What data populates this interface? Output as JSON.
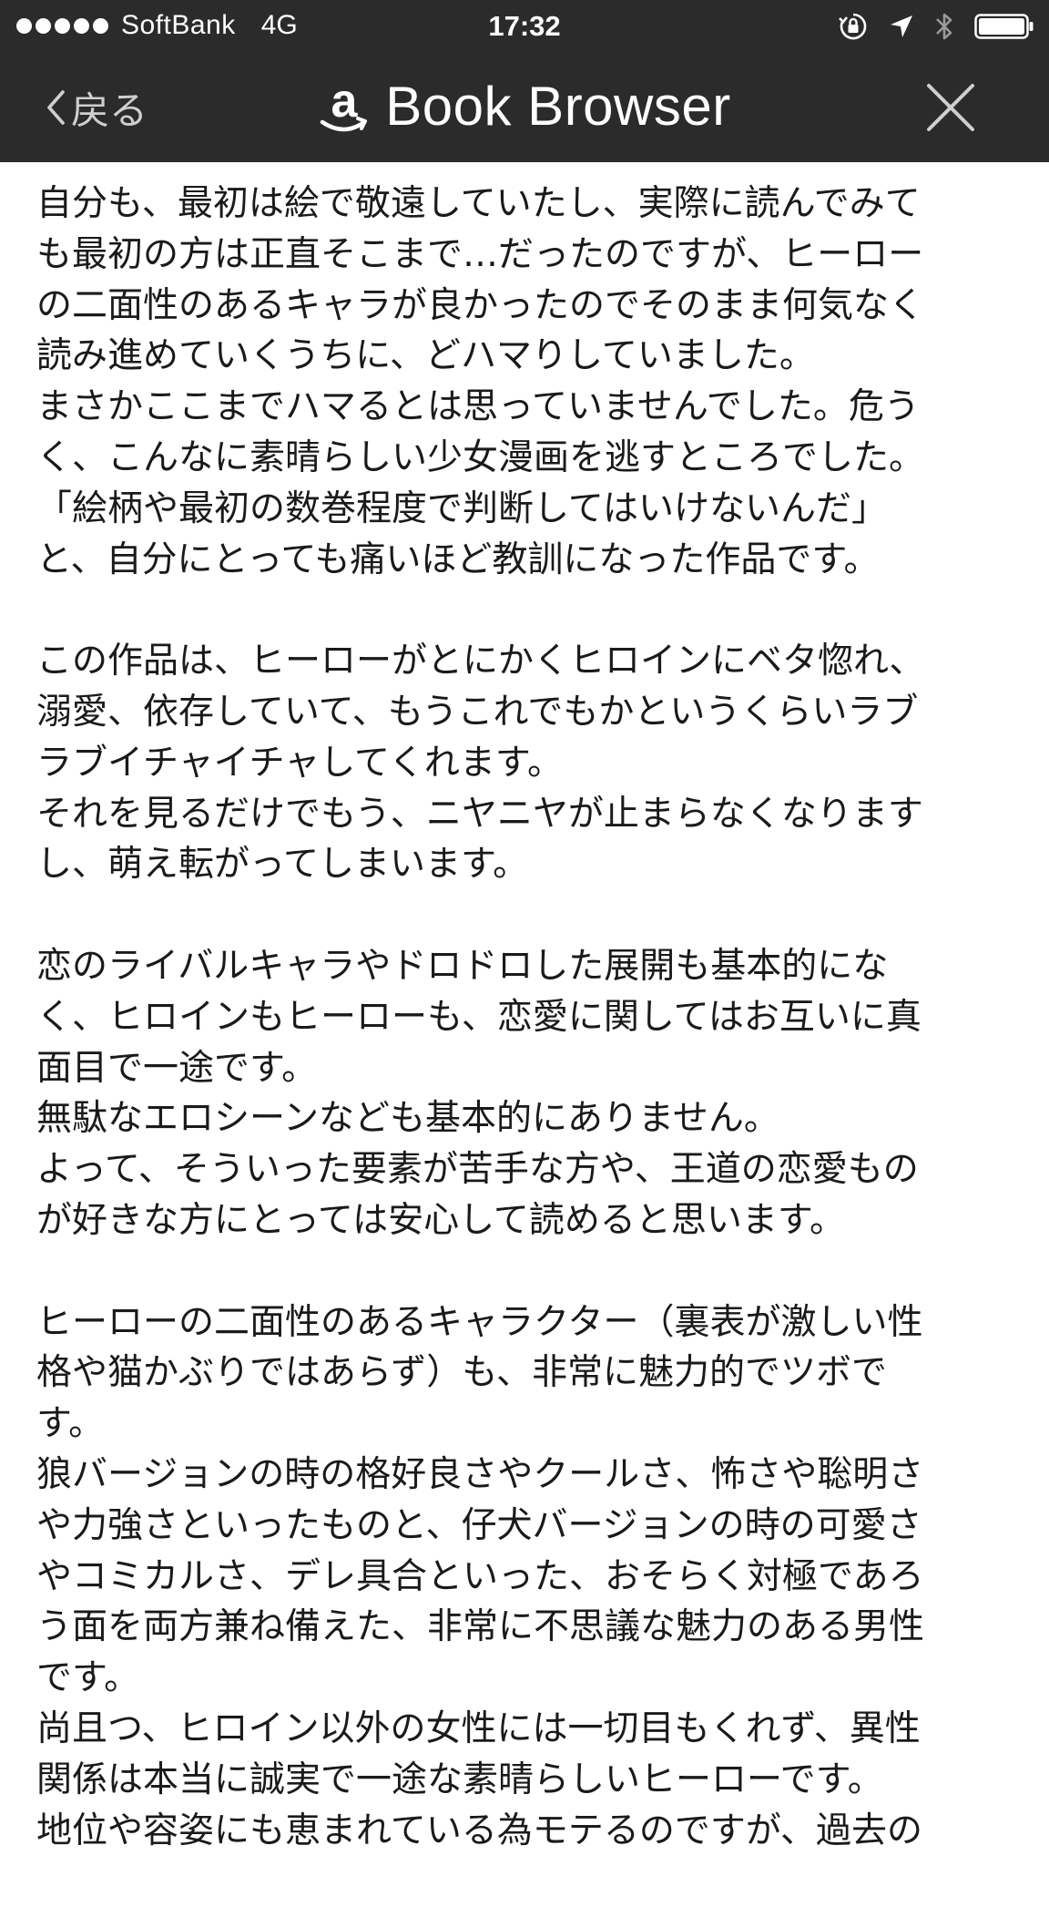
{
  "status_bar": {
    "carrier": "SoftBank",
    "network": "4G",
    "time": "17:32"
  },
  "nav": {
    "back_label": "戻る",
    "title": "Book Browser"
  },
  "paragraphs": [
    [
      "自分も、最初は絵で敬遠していたし、実際に読んでみて",
      "も最初の方は正直そこまで…だったのですが、ヒーロー",
      "の二面性のあるキャラが良かったのでそのまま何気なく",
      "読み進めていくうちに、どハマりしていました。",
      "まさかここまでハマるとは思っていませんでした。危う",
      "く、こんなに素晴らしい少女漫画を逃すところでした。",
      "「絵柄や最初の数巻程度で判断してはいけないんだ」",
      "と、自分にとっても痛いほど教訓になった作品です。"
    ],
    [
      "この作品は、ヒーローがとにかくヒロインにベタ惚れ、",
      "溺愛、依存していて、もうこれでもかというくらいラブ",
      "ラブイチャイチャしてくれます。",
      "それを見るだけでもう、ニヤニヤが止まらなくなります",
      "し、萌え転がってしまいます。"
    ],
    [
      "恋のライバルキャラやドロドロした展開も基本的にな",
      "く、ヒロインもヒーローも、恋愛に関してはお互いに真",
      "面目で一途です。",
      "無駄なエロシーンなども基本的にありません。",
      "よって、そういった要素が苦手な方や、王道の恋愛もの",
      "が好きな方にとっては安心して読めると思います。"
    ],
    [
      "ヒーローの二面性のあるキャラクター（裏表が激しい性",
      "格や猫かぶりではあらず）も、非常に魅力的でツボで",
      "す。",
      "狼バージョンの時の格好良さやクールさ、怖さや聡明さ",
      "や力強さといったものと、仔犬バージョンの時の可愛さ",
      "やコミカルさ、デレ具合といった、おそらく対極であろ",
      "う面を両方兼ね備えた、非常に不思議な魅力のある男性",
      "です。",
      "尚且つ、ヒロイン以外の女性には一切目もくれず、異性",
      "関係は本当に誠実で一途な素晴らしいヒーローです。",
      "地位や容姿にも恵まれている為モテるのですが、過去の"
    ]
  ]
}
